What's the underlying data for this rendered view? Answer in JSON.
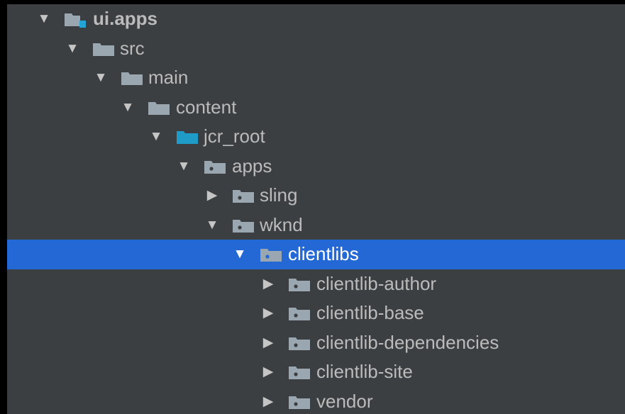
{
  "tree": {
    "rows": [
      {
        "label": "ui.apps",
        "expander": "▼",
        "icon": "module-folder-icon"
      },
      {
        "label": "src",
        "expander": "▼",
        "icon": "folder-icon"
      },
      {
        "label": "main",
        "expander": "▼",
        "icon": "folder-icon"
      },
      {
        "label": "content",
        "expander": "▼",
        "icon": "folder-icon"
      },
      {
        "label": "jcr_root",
        "expander": "▼",
        "icon": "source-root-folder-icon"
      },
      {
        "label": "apps",
        "expander": "▼",
        "icon": "package-folder-icon"
      },
      {
        "label": "sling",
        "expander": "▶",
        "icon": "package-folder-icon"
      },
      {
        "label": "wknd",
        "expander": "▼",
        "icon": "package-folder-icon"
      },
      {
        "label": "clientlibs",
        "expander": "▼",
        "icon": "package-folder-icon",
        "selected": true
      },
      {
        "label": "clientlib-author",
        "expander": "▶",
        "icon": "package-folder-icon"
      },
      {
        "label": "clientlib-base",
        "expander": "▶",
        "icon": "package-folder-icon"
      },
      {
        "label": "clientlib-dependencies",
        "expander": "▶",
        "icon": "package-folder-icon"
      },
      {
        "label": "clientlib-site",
        "expander": "▶",
        "icon": "package-folder-icon"
      },
      {
        "label": "vendor",
        "expander": "▶",
        "icon": "package-folder-icon"
      }
    ]
  },
  "colors": {
    "panel_background": "#3c3f41",
    "selection": "#2368d4",
    "folder_gray": "#9aa7b0",
    "source_root_blue": "#1f9bc7",
    "text": "#bbbbbb"
  }
}
